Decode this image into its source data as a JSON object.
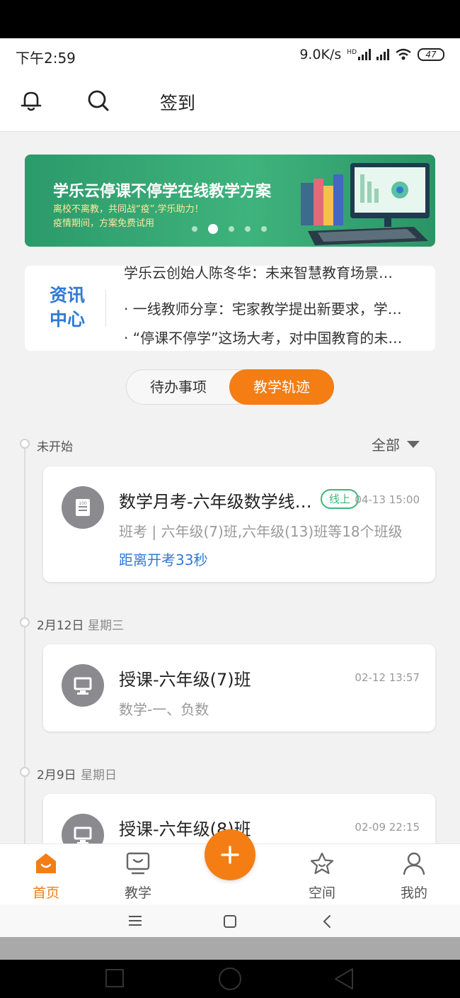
{
  "status_bar": {
    "time": "下午2:59",
    "speed": "9.0K/s",
    "hd": "HD",
    "battery": "47"
  },
  "header": {
    "checkin": "签到"
  },
  "banner": {
    "title": "学乐云停课不停学在线教学方案",
    "subtitle1": "离校不离教，共同战“疫”,学乐助力！",
    "subtitle2": "疫情期间，方案免费试用",
    "page_count": 5,
    "active_page": 2
  },
  "news": {
    "logo_line1": "资讯",
    "logo_line2": "中心",
    "items": [
      "学乐云创始人陈冬华：未来智慧教育场景…",
      "· 一线教师分享：宅家教学提出新要求，学…",
      "· “停课不停学”这场大考，对中国教育的未…"
    ]
  },
  "toggle": {
    "left": "待办事项",
    "right": "教学轨迹"
  },
  "timeline": {
    "filter": "全部",
    "groups": [
      {
        "date": "未开始",
        "week": ""
      },
      {
        "date": "2月12日",
        "week": "星期三"
      },
      {
        "date": "2月9日",
        "week": "星期日"
      }
    ]
  },
  "cards": [
    {
      "title": "数学月考-六年级数学线…",
      "tag": "线上",
      "time": "04-13 15:00",
      "sub": "班考 | 六年级(7)班,六年级(13)班等18个班级",
      "countdown": "距离开考33秒",
      "icon": "exam-icon"
    },
    {
      "title": "授课-六年级(7)班",
      "time": "02-12 13:57",
      "sub": "数学-一、负数",
      "icon": "monitor-icon"
    },
    {
      "title": "授课-六年级(8)班",
      "time": "02-09 22:15",
      "icon": "monitor-icon"
    }
  ],
  "tabbar": {
    "items": [
      {
        "label": "首页",
        "icon": "home-icon"
      },
      {
        "label": "教学",
        "icon": "teach-icon"
      },
      {
        "label": "空间",
        "icon": "star-icon"
      },
      {
        "label": "我的",
        "icon": "user-icon"
      }
    ],
    "active_index": 0
  },
  "colors": {
    "accent": "#f47d14",
    "link": "#2f7ad6",
    "online": "#3cb679",
    "banner": "#3fb37c"
  }
}
